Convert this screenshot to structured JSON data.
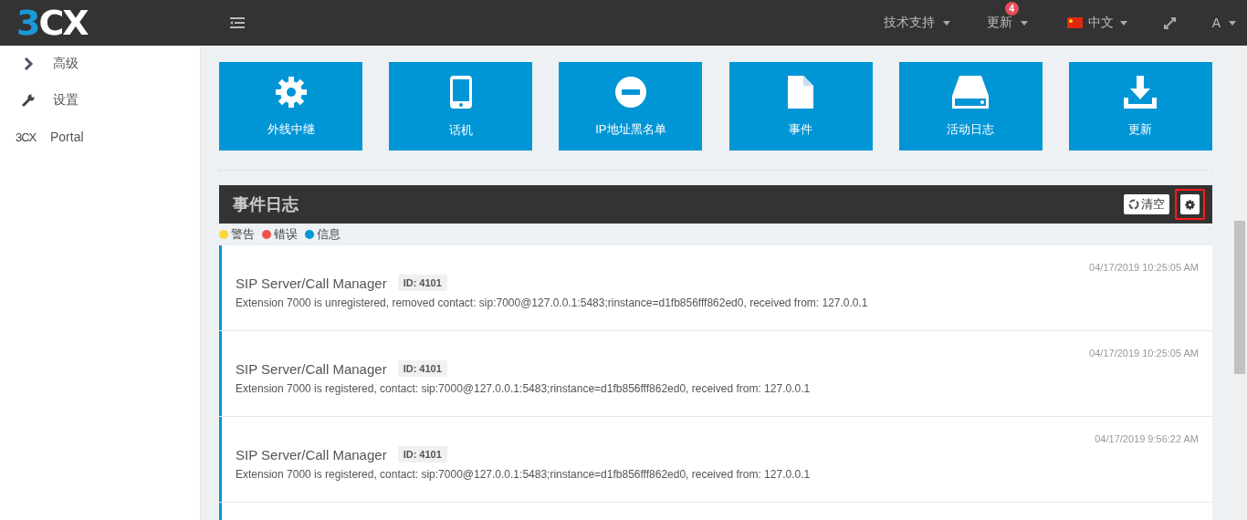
{
  "header": {
    "logo": "3CX",
    "menu": [
      {
        "kind": "dropdown",
        "label": "技术支持"
      },
      {
        "kind": "badge-dropdown",
        "label": "更新",
        "badge": "4"
      },
      {
        "kind": "flag-dropdown",
        "label": "中文"
      },
      {
        "kind": "expand"
      },
      {
        "kind": "dropdown",
        "label": "A"
      }
    ]
  },
  "sidebar": {
    "items": [
      {
        "kind": "chevron",
        "label": "高级"
      },
      {
        "kind": "wrench",
        "label": "设置"
      },
      {
        "kind": "logo",
        "icon_text": "3CX",
        "label": "Portal"
      }
    ]
  },
  "tiles": [
    {
      "kind": "gear",
      "label": "外线中继"
    },
    {
      "kind": "phone",
      "label": "话机"
    },
    {
      "kind": "minus",
      "label": "IP地址黑名单"
    },
    {
      "kind": "file",
      "label": "事件"
    },
    {
      "kind": "drive",
      "label": "活动日志"
    },
    {
      "kind": "download",
      "label": "更新"
    }
  ],
  "event_log": {
    "title": "事件日志",
    "clear_button": "清空",
    "settings_highlighted": true,
    "legend": [
      {
        "label": "警告",
        "color": "#fdd835"
      },
      {
        "label": "错误",
        "color": "#ef5350"
      },
      {
        "label": "信息",
        "color": "#0096d6"
      }
    ],
    "events": [
      {
        "source": "SIP Server/Call Manager",
        "id": "ID: 4101",
        "message": "Extension 7000 is unregistered, removed contact: sip:7000@127.0.0.1:5483;rinstance=d1fb856fff862ed0, received from: 127.0.0.1",
        "time": "04/17/2019 10:25:05 AM",
        "color": "#0096d6"
      },
      {
        "source": "SIP Server/Call Manager",
        "id": "ID: 4101",
        "message": "Extension 7000 is registered, contact: sip:7000@127.0.0.1:5483;rinstance=d1fb856fff862ed0, received from: 127.0.0.1",
        "time": "04/17/2019 10:25:05 AM",
        "color": "#0096d6"
      },
      {
        "source": "SIP Server/Call Manager",
        "id": "ID: 4101",
        "message": "Extension 7000 is registered, contact: sip:7000@127.0.0.1:5483;rinstance=d1fb856fff862ed0, received from: 127.0.0.1",
        "time": "04/17/2019 9:56:22 AM",
        "color": "#0096d6"
      }
    ]
  }
}
